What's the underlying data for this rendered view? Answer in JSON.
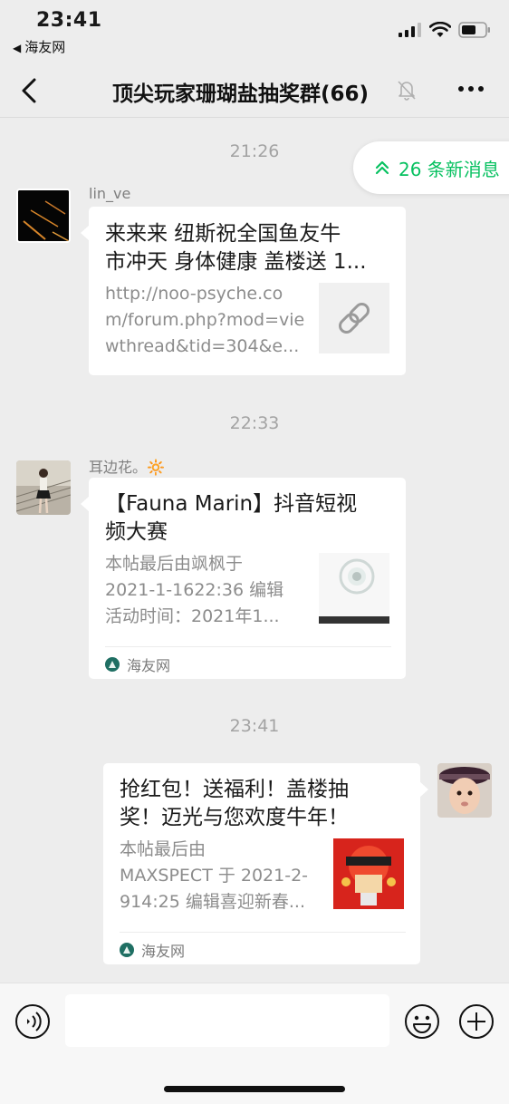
{
  "status_bar": {
    "time": "23:41",
    "back_app": "海友网"
  },
  "nav": {
    "title": "顶尖玩家珊瑚盐抽奖群(66)"
  },
  "new_messages": "26 条新消息",
  "messages": [
    {
      "timestamp": "21:26",
      "sender": "lin_ve",
      "title_line1": "来来来 纽斯祝全国鱼友牛",
      "title_line2": "市冲天 身体健康 盖楼送 1...",
      "desc_line1": "http://noo-psyche.co",
      "desc_line2": "m/forum.php?mod=vie",
      "desc_line3": "wthread&tid=304&e..."
    },
    {
      "timestamp": "22:33",
      "sender": "耳边花。🔆",
      "title_line1": "【Fauna Marin】抖音短视",
      "title_line2": "频大赛",
      "desc_line1": "本帖最后由飒枫于",
      "desc_line2": "2021-1-1622:36 编辑",
      "desc_line3": "活动时间：2021年1...",
      "source": "海友网"
    },
    {
      "timestamp": "23:41",
      "title_line1": "抢红包！送福利！盖楼抽",
      "title_line2": "奖！迈光与您欢度牛年！",
      "desc_line1": "本帖最后由",
      "desc_line2": "MAXSPECT 于 2021-2-",
      "desc_line3": "914:25 编辑喜迎新春...",
      "source": "海友网"
    }
  ],
  "input": {
    "placeholder": ""
  }
}
